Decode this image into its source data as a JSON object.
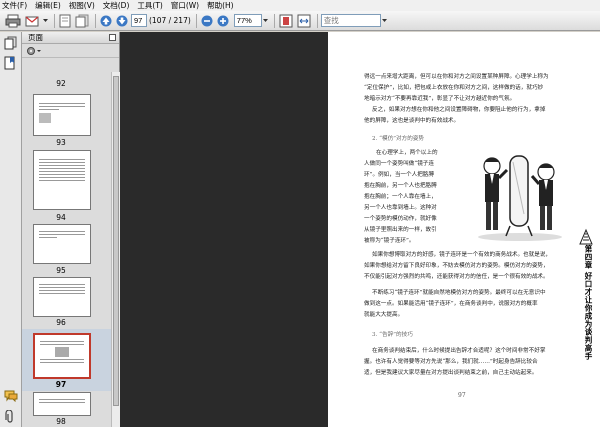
{
  "menu": [
    "文件(F)",
    "编辑(E)",
    "视图(V)",
    "文档(D)",
    "工具(T)",
    "窗口(W)",
    "帮助(H)"
  ],
  "toolbar": {
    "page_current": "97",
    "page_total": "(107 / 217)",
    "zoom": "77%",
    "search_placeholder": "查找"
  },
  "panel": {
    "title": "页面",
    "thumbnails": [
      "92",
      "93",
      "94",
      "95",
      "96",
      "97",
      "98"
    ],
    "selected": "97"
  },
  "page_content": {
    "lines_top": [
      "得远一点来增大距离，但可以在你和对方之间设置某种屏障。心理学上称为",
      "“定位保护”，比如，把包或上衣放在你和对方之间，这样做的话，就巧妙",
      "地暗示对方“不要再靠近我”，彰显了不让对方越近你的气氛。",
      "反之，如果对方想在你和他之间设置障碍物，你要阻止他的行为，拿掉",
      "他的屏障，这也是谈判中的有效战术。"
    ],
    "section_heading": "2. “模仿”对方的姿势",
    "lines_mid": [
      "在心理学上，两个以上的",
      "人做同一个姿势叫做“镜子连",
      "环”。例如，当一个人把胳膊",
      "抱在胸前，另一个人也把胳膊",
      "抱在胸前；一个人靠在墙上，",
      "另一个人也靠到墙上。这种对",
      "一个姿势的模仿动作，就好像",
      "从镜子里照出来的一样，故引",
      "被称为“镜子连环”。"
    ],
    "lines_bottom": [
      "如果你想博取对方的好感，镜子连环是一个有效的商务战术。也就是说，",
      "如果你想给对方留下良好印象，不妨去模仿对方的姿势。模仿对方的姿势，",
      "不仅能引起对方强烈的共鸣，还能获得对方的信任，是一个很有效的战术。",
      "不断练习“镜子连环”就能自然地模仿对方的姿势。最终可以在无意识中",
      "做到这一点。如果能活用“镜子连环”，在商务谈判中，说服对方的概率",
      "就能大大提高。"
    ],
    "section_heading2": "3. “告辞”的技巧",
    "lines_end": [
      "在商务谈判结束后，什么时候提出告辞才合适呢？这个时间非常不好掌",
      "握。也许有人觉得要等对方先说“那么，我们就……”时起身告辞比较合",
      "适，但是我建议大家尽量在对方提出谈判结束之前，自己主动站起来。"
    ],
    "chapter_tab": "第四章 好口才让你成为谈判高手",
    "page_number": "97"
  }
}
